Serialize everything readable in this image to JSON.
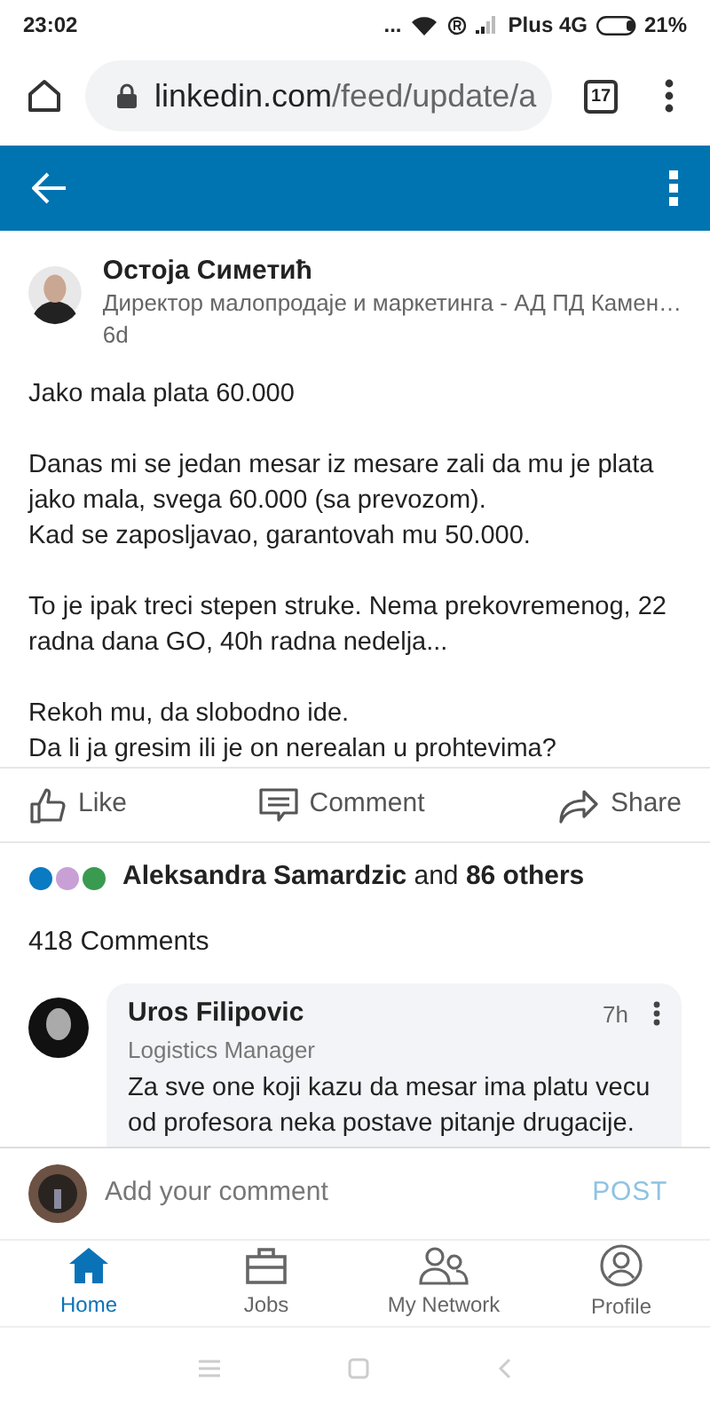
{
  "status_bar": {
    "time": "23:02",
    "dots": "...",
    "carrier": "Plus 4G",
    "battery": "21%"
  },
  "browser": {
    "url_host": "linkedin.com",
    "url_path": "/feed/update/a",
    "tab_count": "17"
  },
  "post": {
    "author": "Остоја Симетић",
    "headline": "Директор малопродаје и маркетинга - АД ПД Камен…",
    "age": "6d",
    "paragraphs": [
      [
        "Jako mala plata 60.000"
      ],
      [
        "Danas mi se jedan mesar iz mesare zali da mu je plata jako mala, svega 60.000 (sa prevozom).",
        "Kad se zaposljavao, garantovah mu 50.000."
      ],
      [
        "To je ipak treci stepen struke. Nema prekovremenog, 22 radna dana GO, 40h radna nedelja..."
      ],
      [
        "Rekoh mu, da slobodno ide.",
        "Da li ja gresim ili je on nerealan u prohtevima?"
      ]
    ],
    "actions": [
      {
        "kind": "like",
        "label": "Like"
      },
      {
        "kind": "comment",
        "label": "Comment"
      },
      {
        "kind": "share",
        "label": "Share"
      }
    ],
    "reactions": "**Aleksandra Samardzic** and **86 others**",
    "comment_count": "418 Comments"
  },
  "comment": {
    "author": "Uros Filipovic",
    "headline": "Logistics Manager",
    "age": "7h",
    "text": "Za sve one koji kazu da mesar ima platu vecu od profesora neka postave pitanje drugacije."
  },
  "composer": {
    "placeholder": "Add your comment",
    "post_label": "POST"
  },
  "nav": [
    {
      "kind": "home",
      "label": "Home",
      "selected": true
    },
    {
      "kind": "jobs",
      "label": "Jobs",
      "selected": false
    },
    {
      "kind": "network",
      "label": "My Network",
      "selected": false
    },
    {
      "kind": "profile",
      "label": "Profile",
      "selected": false
    }
  ]
}
